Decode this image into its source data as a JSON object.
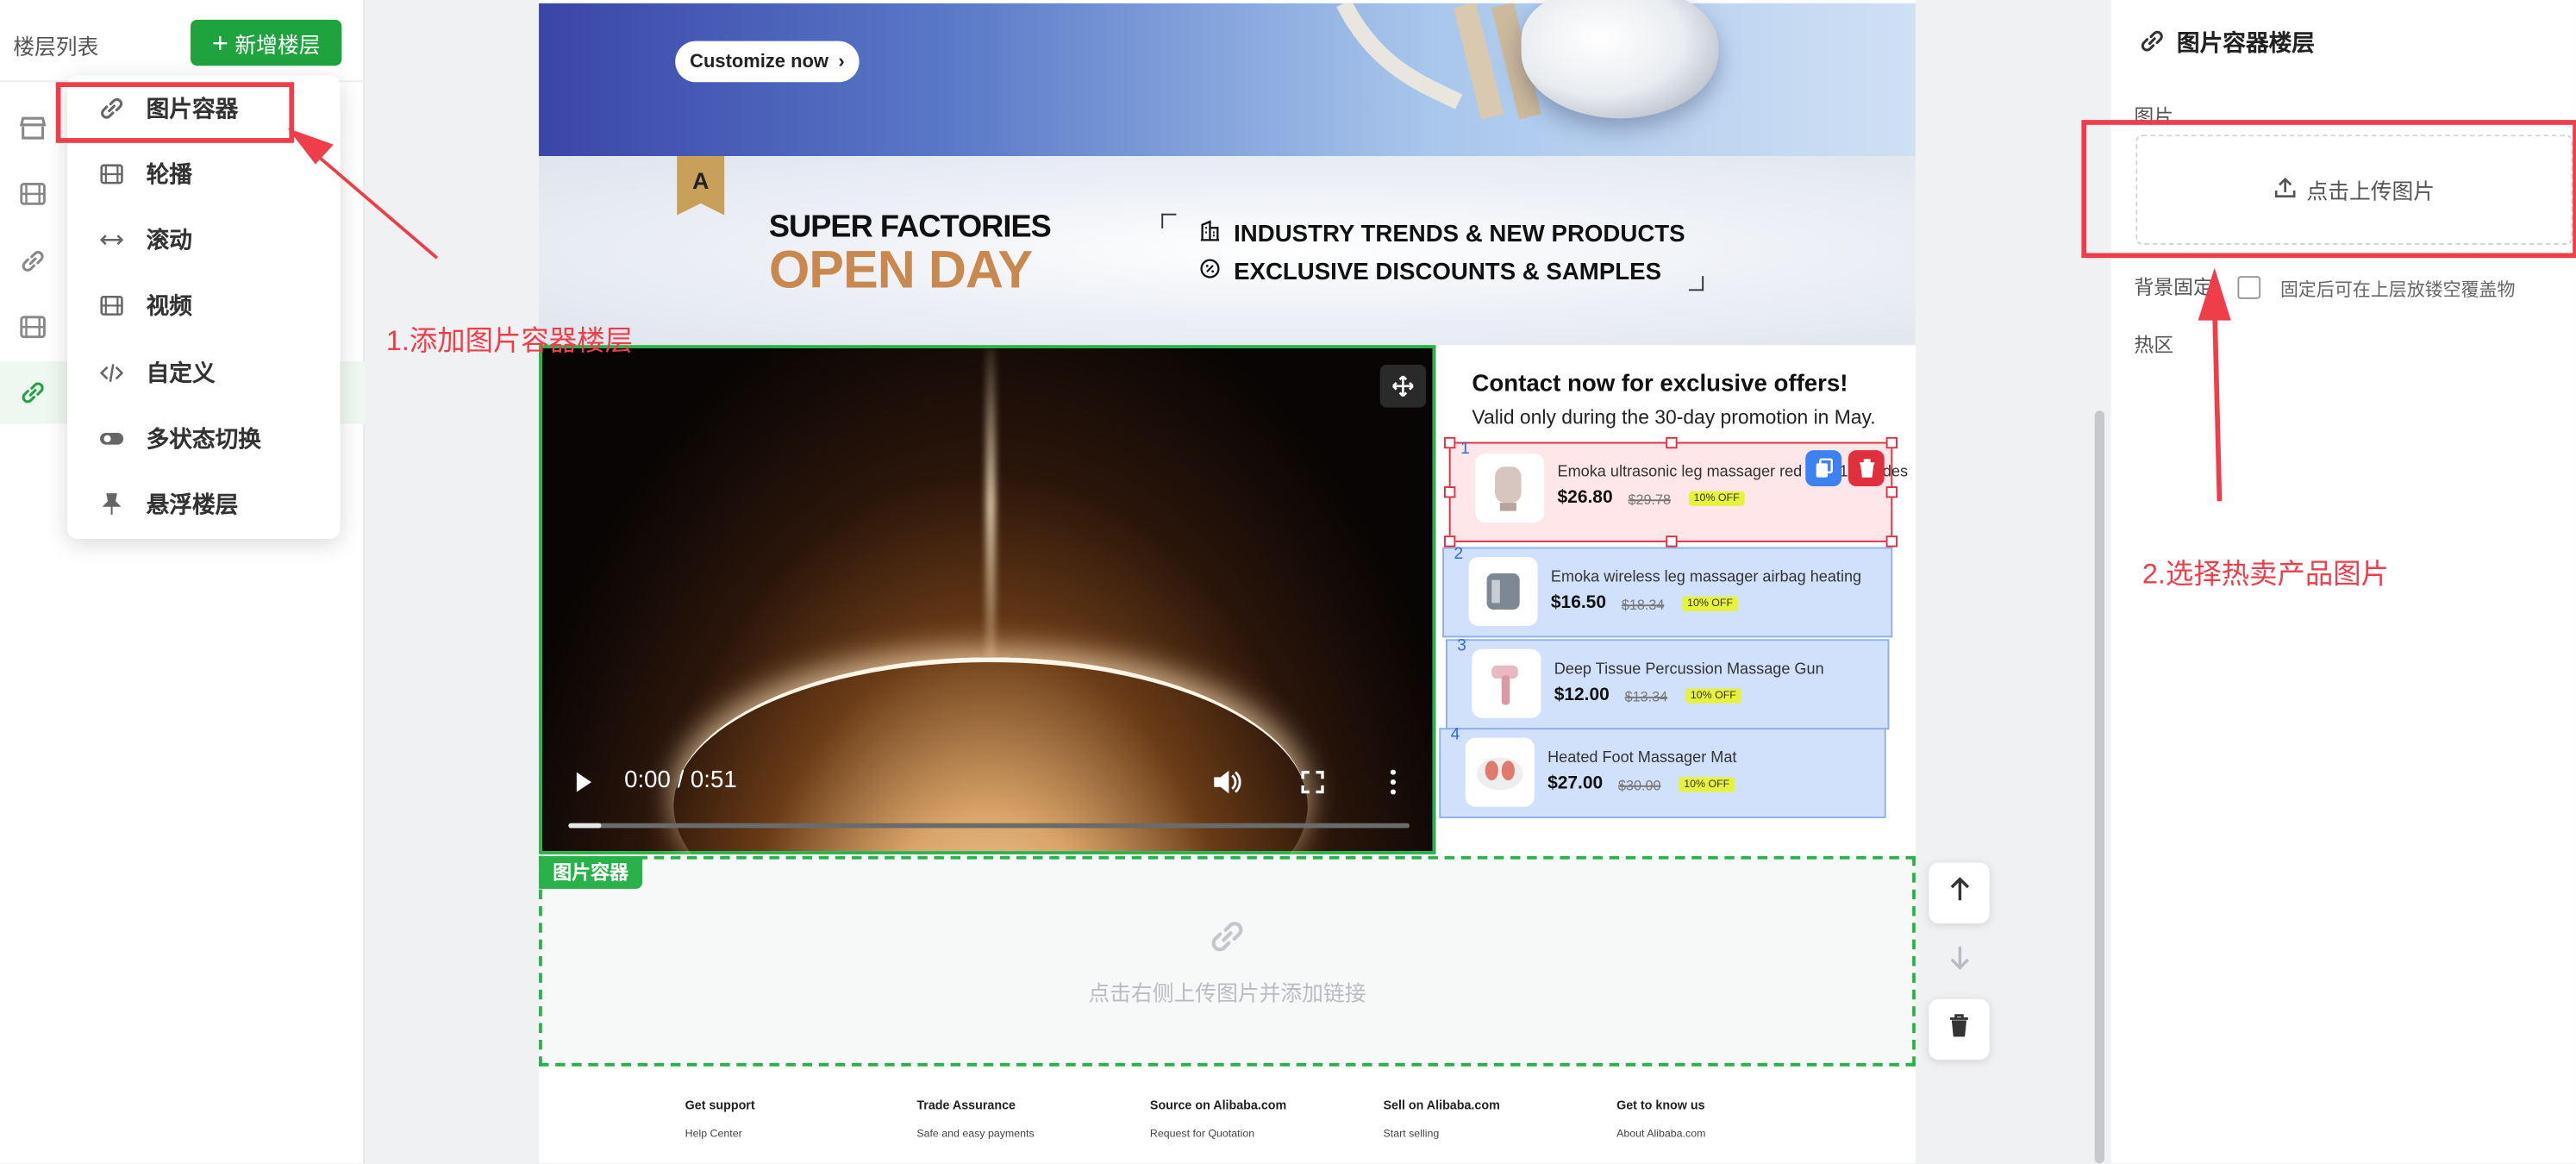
{
  "sidebar": {
    "title": "楼层列表",
    "add_button": "新增楼层",
    "rows": [
      {
        "icon": "store-icon"
      },
      {
        "icon": "film-icon"
      },
      {
        "icon": "link-icon"
      },
      {
        "icon": "film-icon"
      },
      {
        "icon": "link-icon",
        "active": true
      }
    ]
  },
  "menu": {
    "items": [
      {
        "label": "图片容器",
        "icon": "link-icon"
      },
      {
        "label": "轮播",
        "icon": "film-icon"
      },
      {
        "label": "滚动",
        "icon": "arrows-horizontal-icon"
      },
      {
        "label": "视频",
        "icon": "film-icon"
      },
      {
        "label": "自定义",
        "icon": "code-icon"
      },
      {
        "label": "多状态切换",
        "icon": "toggle-icon"
      },
      {
        "label": "悬浮楼层",
        "icon": "pin-icon"
      }
    ]
  },
  "banner1": {
    "cta": "Customize now"
  },
  "banner2": {
    "line1": "SUPER FACTORIES",
    "line2": "OPEN DAY",
    "feature1": "INDUSTRY TRENDS & NEW PRODUCTS",
    "feature2": "EXCLUSIVE DISCOUNTS & SAMPLES",
    "logo_letter": "A"
  },
  "video": {
    "time": "0:00 / 0:51",
    "progress": 0.04
  },
  "offers": {
    "title": "Contact now for exclusive offers!",
    "subtitle": "Valid only during the 30-day promotion in May.",
    "products": [
      {
        "num": "1",
        "name": "Emoka ultrasonic leg massager red light 12 modes",
        "price": "$26.80",
        "old": "$29.78",
        "badge": "10% OFF",
        "selected": true
      },
      {
        "num": "2",
        "name": "Emoka wireless leg massager airbag heating",
        "price": "$16.50",
        "old": "$18.34",
        "badge": "10% OFF"
      },
      {
        "num": "3",
        "name": "Deep Tissue Percussion Massage Gun",
        "price": "$12.00",
        "old": "$13.34",
        "badge": "10% OFF"
      },
      {
        "num": "4",
        "name": "Heated Foot Massager Mat",
        "price": "$27.00",
        "old": "$30.00",
        "badge": "10% OFF"
      }
    ]
  },
  "image_container": {
    "tag": "图片容器",
    "hint": "点击右侧上传图片并添加链接"
  },
  "footer": {
    "columns": [
      {
        "heading": "Get support",
        "item": "Help Center"
      },
      {
        "heading": "Trade Assurance",
        "item": "Safe and easy payments"
      },
      {
        "heading": "Source on Alibaba.com",
        "item": "Request for Quotation"
      },
      {
        "heading": "Sell on Alibaba.com",
        "item": "Start selling"
      },
      {
        "heading": "Get to know us",
        "item": "About Alibaba.com"
      }
    ]
  },
  "panel": {
    "title": "图片容器楼层",
    "image_label": "图片",
    "upload": "点击上传图片",
    "bg_fixed_label": "背景固定",
    "bg_fixed_desc": "固定后可在上层放镂空覆盖物",
    "hotspot_label": "热区"
  },
  "annotations": {
    "step1": "1.添加图片容器楼层",
    "step2": "2.选择热卖产品图片"
  },
  "colors": {
    "accent": "#1fa33f",
    "annotation": "#ef3e4a",
    "hotspot": "#8fb0ec"
  }
}
